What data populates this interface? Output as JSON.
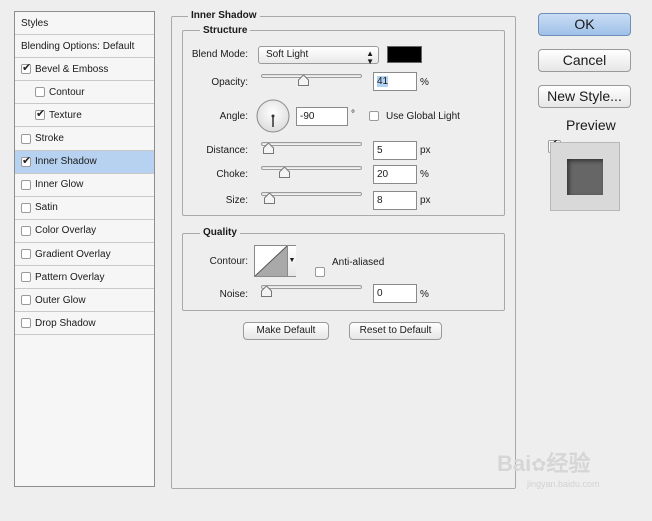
{
  "styles_panel": {
    "items": [
      {
        "label": "Styles",
        "checkbox": false,
        "checked": false,
        "sub": false,
        "selected": false
      },
      {
        "label": "Blending Options: Default",
        "checkbox": false,
        "checked": false,
        "sub": false,
        "selected": false
      },
      {
        "label": "Bevel & Emboss",
        "checkbox": true,
        "checked": true,
        "sub": false,
        "selected": false
      },
      {
        "label": "Contour",
        "checkbox": true,
        "checked": false,
        "sub": true,
        "selected": false
      },
      {
        "label": "Texture",
        "checkbox": true,
        "checked": true,
        "sub": true,
        "selected": false
      },
      {
        "label": "Stroke",
        "checkbox": true,
        "checked": false,
        "sub": false,
        "selected": false
      },
      {
        "label": "Inner Shadow",
        "checkbox": true,
        "checked": true,
        "sub": false,
        "selected": true
      },
      {
        "label": "Inner Glow",
        "checkbox": true,
        "checked": false,
        "sub": false,
        "selected": false
      },
      {
        "label": "Satin",
        "checkbox": true,
        "checked": false,
        "sub": false,
        "selected": false
      },
      {
        "label": "Color Overlay",
        "checkbox": true,
        "checked": false,
        "sub": false,
        "selected": false
      },
      {
        "label": "Gradient Overlay",
        "checkbox": true,
        "checked": false,
        "sub": false,
        "selected": false
      },
      {
        "label": "Pattern Overlay",
        "checkbox": true,
        "checked": false,
        "sub": false,
        "selected": false
      },
      {
        "label": "Outer Glow",
        "checkbox": true,
        "checked": false,
        "sub": false,
        "selected": false
      },
      {
        "label": "Drop Shadow",
        "checkbox": true,
        "checked": false,
        "sub": false,
        "selected": false
      }
    ]
  },
  "inner_shadow": {
    "title": "Inner Shadow",
    "structure": {
      "title": "Structure",
      "blend_mode_label": "Blend Mode:",
      "blend_mode_value": "Soft Light",
      "shadow_color": "#000000",
      "opacity_label": "Opacity:",
      "opacity_value": "41",
      "opacity_unit": "%",
      "opacity_fraction": 0.41,
      "angle_label": "Angle:",
      "angle_value": "-90",
      "angle_unit": "°",
      "use_global_light_label": "Use Global Light",
      "use_global_light_checked": false,
      "distance_label": "Distance:",
      "distance_value": "5",
      "distance_unit": "px",
      "distance_fraction": 0.02,
      "choke_label": "Choke:",
      "choke_value": "20",
      "choke_unit": "%",
      "choke_fraction": 0.2,
      "size_label": "Size:",
      "size_value": "8",
      "size_unit": "px",
      "size_fraction": 0.03
    },
    "quality": {
      "title": "Quality",
      "contour_label": "Contour:",
      "anti_aliased_label": "Anti-aliased",
      "anti_aliased_checked": false,
      "noise_label": "Noise:",
      "noise_value": "0",
      "noise_unit": "%",
      "noise_fraction": 0.0
    },
    "make_default_label": "Make Default",
    "reset_default_label": "Reset to Default"
  },
  "actions": {
    "ok_label": "OK",
    "cancel_label": "Cancel",
    "new_style_label": "New Style...",
    "preview_label": "Preview",
    "preview_checked": true
  },
  "watermark": {
    "brand": "Bai",
    "brand_tail": "经验",
    "url": "jingyan.baidu.com"
  }
}
